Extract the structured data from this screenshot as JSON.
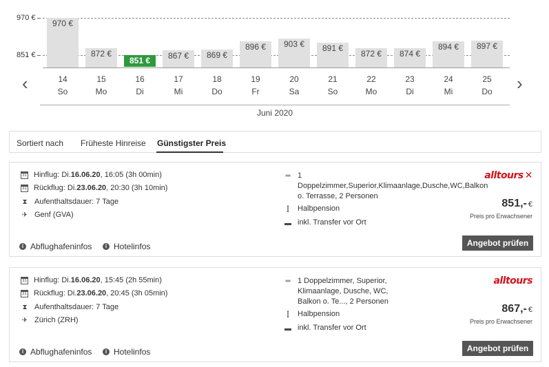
{
  "chart_data": {
    "type": "bar",
    "y_ticks": [
      {
        "value": 970,
        "label": "970 €"
      },
      {
        "value": 851,
        "label": "851 €"
      }
    ],
    "days": [
      {
        "day": "14",
        "weekday": "So",
        "price": 970,
        "label": "970 €",
        "selected": false
      },
      {
        "day": "15",
        "weekday": "Mo",
        "price": 872,
        "label": "872 €",
        "selected": false
      },
      {
        "day": "16",
        "weekday": "Di",
        "price": 851,
        "label": "851 €",
        "selected": true
      },
      {
        "day": "17",
        "weekday": "Mi",
        "price": 867,
        "label": "867 €",
        "selected": false
      },
      {
        "day": "18",
        "weekday": "Do",
        "price": 869,
        "label": "869 €",
        "selected": false
      },
      {
        "day": "19",
        "weekday": "Fr",
        "price": 896,
        "label": "896 €",
        "selected": false
      },
      {
        "day": "20",
        "weekday": "Sa",
        "price": 903,
        "label": "903 €",
        "selected": false
      },
      {
        "day": "21",
        "weekday": "So",
        "price": 891,
        "label": "891 €",
        "selected": false
      },
      {
        "day": "22",
        "weekday": "Mo",
        "price": 872,
        "label": "872 €",
        "selected": false
      },
      {
        "day": "23",
        "weekday": "Di",
        "price": 874,
        "label": "874 €",
        "selected": false
      },
      {
        "day": "24",
        "weekday": "Mi",
        "price": 894,
        "label": "894 €",
        "selected": false
      },
      {
        "day": "25",
        "weekday": "Do",
        "price": 897,
        "label": "897 €",
        "selected": false
      }
    ],
    "month": "Juni 2020",
    "selected_color": "#2f9a3d",
    "bar_color": "#e0e0e0"
  },
  "nav": {
    "prev_icon": "chevron-left-icon",
    "next_icon": "chevron-right-icon"
  },
  "sort": {
    "label": "Sortiert nach",
    "options": [
      "Früheste Hinreise",
      "Günstigster Preis"
    ],
    "active": "Günstigster Preis"
  },
  "offers": [
    {
      "hinflug_prefix": "Hinflug: Di. ",
      "hinflug_date": "16.06.20",
      "hinflug_rest": ", 16:05 (3h 00min)",
      "rueckflug_prefix": "Rückflug: Di. ",
      "rueckflug_date": "23.06.20",
      "rueckflug_rest": ", 20:30 (3h 10min)",
      "stay": "Aufenthaltsdauer: 7 Tage",
      "airport": "Genf (GVA)",
      "room": [
        "1",
        "Doppelzimmer,Superior,Klimaanlage,Dusche,WC,Balkon",
        "o. Terrasse, 2 Personen"
      ],
      "board": "Halbpension",
      "transfer": "inkl. Transfer vor Ort",
      "operator": "alltours",
      "operator_mark": "✕",
      "price": "851,-",
      "currency": "€",
      "price_note": "Preis pro Erwachsener",
      "cta": "Angebot prüfen",
      "airport_info": "Abflughafeninfos",
      "hotel_info": "Hotelinfos"
    },
    {
      "hinflug_prefix": "Hinflug: Di. ",
      "hinflug_date": "16.06.20",
      "hinflug_rest": ", 15:45 (2h 55min)",
      "rueckflug_prefix": "Rückflug: Di. ",
      "rueckflug_date": "23.06.20",
      "rueckflug_rest": ", 20:45 (3h 05min)",
      "stay": "Aufenthaltsdauer: 7 Tage",
      "airport": "Zürich (ZRH)",
      "room": [
        "1 Doppelzimmer, Superior,",
        "Klimaanlage, Dusche, WC,",
        "Balkon o. Te..., 2 Personen"
      ],
      "board": "Halbpension",
      "transfer": "inkl. Transfer vor Ort",
      "operator": "alltours",
      "operator_mark": "",
      "price": "867,-",
      "currency": "€",
      "price_note": "Preis pro Erwachsener",
      "cta": "Angebot prüfen",
      "airport_info": "Abflughafeninfos",
      "hotel_info": "Hotelinfos"
    }
  ],
  "colors": {
    "brand": "#d4141c",
    "button": "#555555",
    "accent": "#2f9a3d"
  }
}
